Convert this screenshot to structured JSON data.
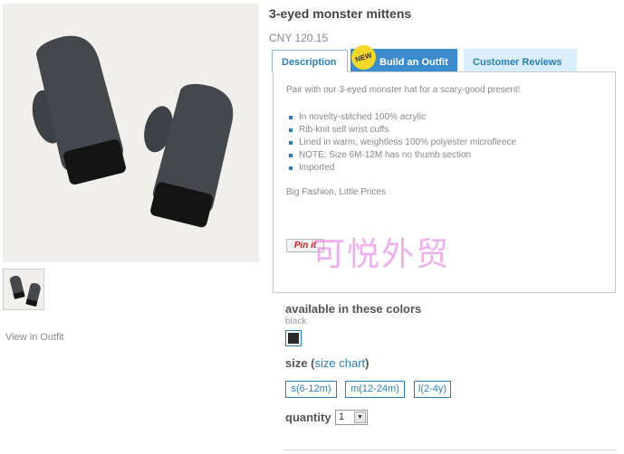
{
  "product": {
    "title": "3-eyed monster mittens",
    "price": "CNY 120.15"
  },
  "left": {
    "main_image_alt": "black knit mittens",
    "view_in_outfit": "View in Outfit"
  },
  "tabs": [
    {
      "label": "Description",
      "active": true
    },
    {
      "label": "Build an Outfit",
      "badge": "NEW"
    },
    {
      "label": "Customer Reviews"
    }
  ],
  "description": {
    "intro": "Pair with our 3-eyed monster hat for a scary-good present!",
    "features": [
      "In novelty-stitched 100% acrylic",
      "Rib-knit self wrist cuffs",
      "Lined in warm, weightless 100% polyester microfleece",
      "NOTE: Size 6M-12M has no thumb section",
      "Imported"
    ],
    "tagline": "Big Fashion, Little Prices",
    "pinit_label": "Pin it",
    "watermark": "可悦外贸"
  },
  "colors": {
    "heading": "available in these colors",
    "selected_name": "black",
    "swatch_color": "#2a2a2a"
  },
  "size": {
    "heading_prefix": "size (",
    "chart_link": "size chart",
    "heading_suffix": ")",
    "options": [
      "s(6-12m)",
      "m(12-24m)",
      "l(2-4y)"
    ]
  },
  "quantity": {
    "label": "quantity",
    "value": "1"
  },
  "colors_palette": {
    "accent": "#2a7fb6",
    "tab_active_bg": "#3a8ccc",
    "tab_inactive_bg": "#d9eef8",
    "badge": "#f5d82a"
  }
}
